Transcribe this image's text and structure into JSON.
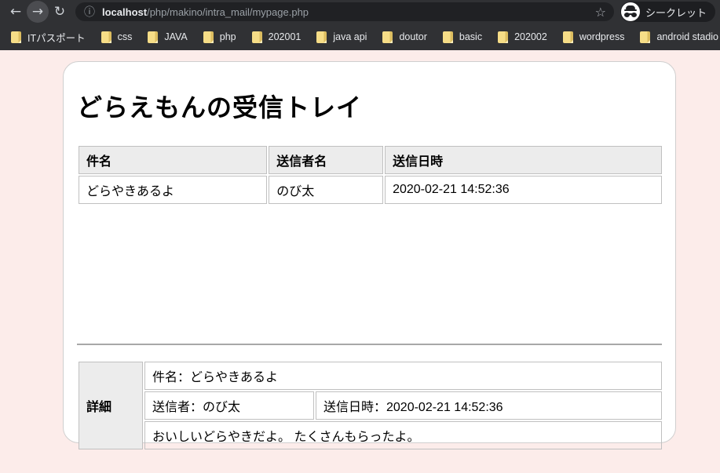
{
  "browser": {
    "url_host": "localhost",
    "url_path": "/php/makino/intra_mail/mypage.php",
    "incognito_label": "シークレット",
    "bookmarks": [
      "ITパスポート",
      "css",
      "JAVA",
      "php",
      "202001",
      "java api",
      "doutor",
      "basic",
      "202002",
      "wordpress",
      "android stadio"
    ]
  },
  "page": {
    "title": "どらえもんの受信トレイ",
    "inbox_table": {
      "headers": [
        "件名",
        "送信者名",
        "送信日時"
      ],
      "rows": [
        [
          "どらやきあるよ",
          "のび太",
          "2020-02-21 14:52:36"
        ]
      ]
    },
    "detail": {
      "label": "詳細",
      "subject": "件名：どらやきあるよ",
      "sender": "送信者：のび太",
      "sent_at": "送信日時：2020-02-21 14:52:36",
      "body": "おいしいどらやきだよ。 たくさんもらったよ。"
    }
  },
  "colors": {
    "page_background": "#fcecea",
    "toolbar": "#303134",
    "omnibox": "#202124",
    "folder_icon": "#f0d170",
    "table_header_bg": "#ececec"
  }
}
